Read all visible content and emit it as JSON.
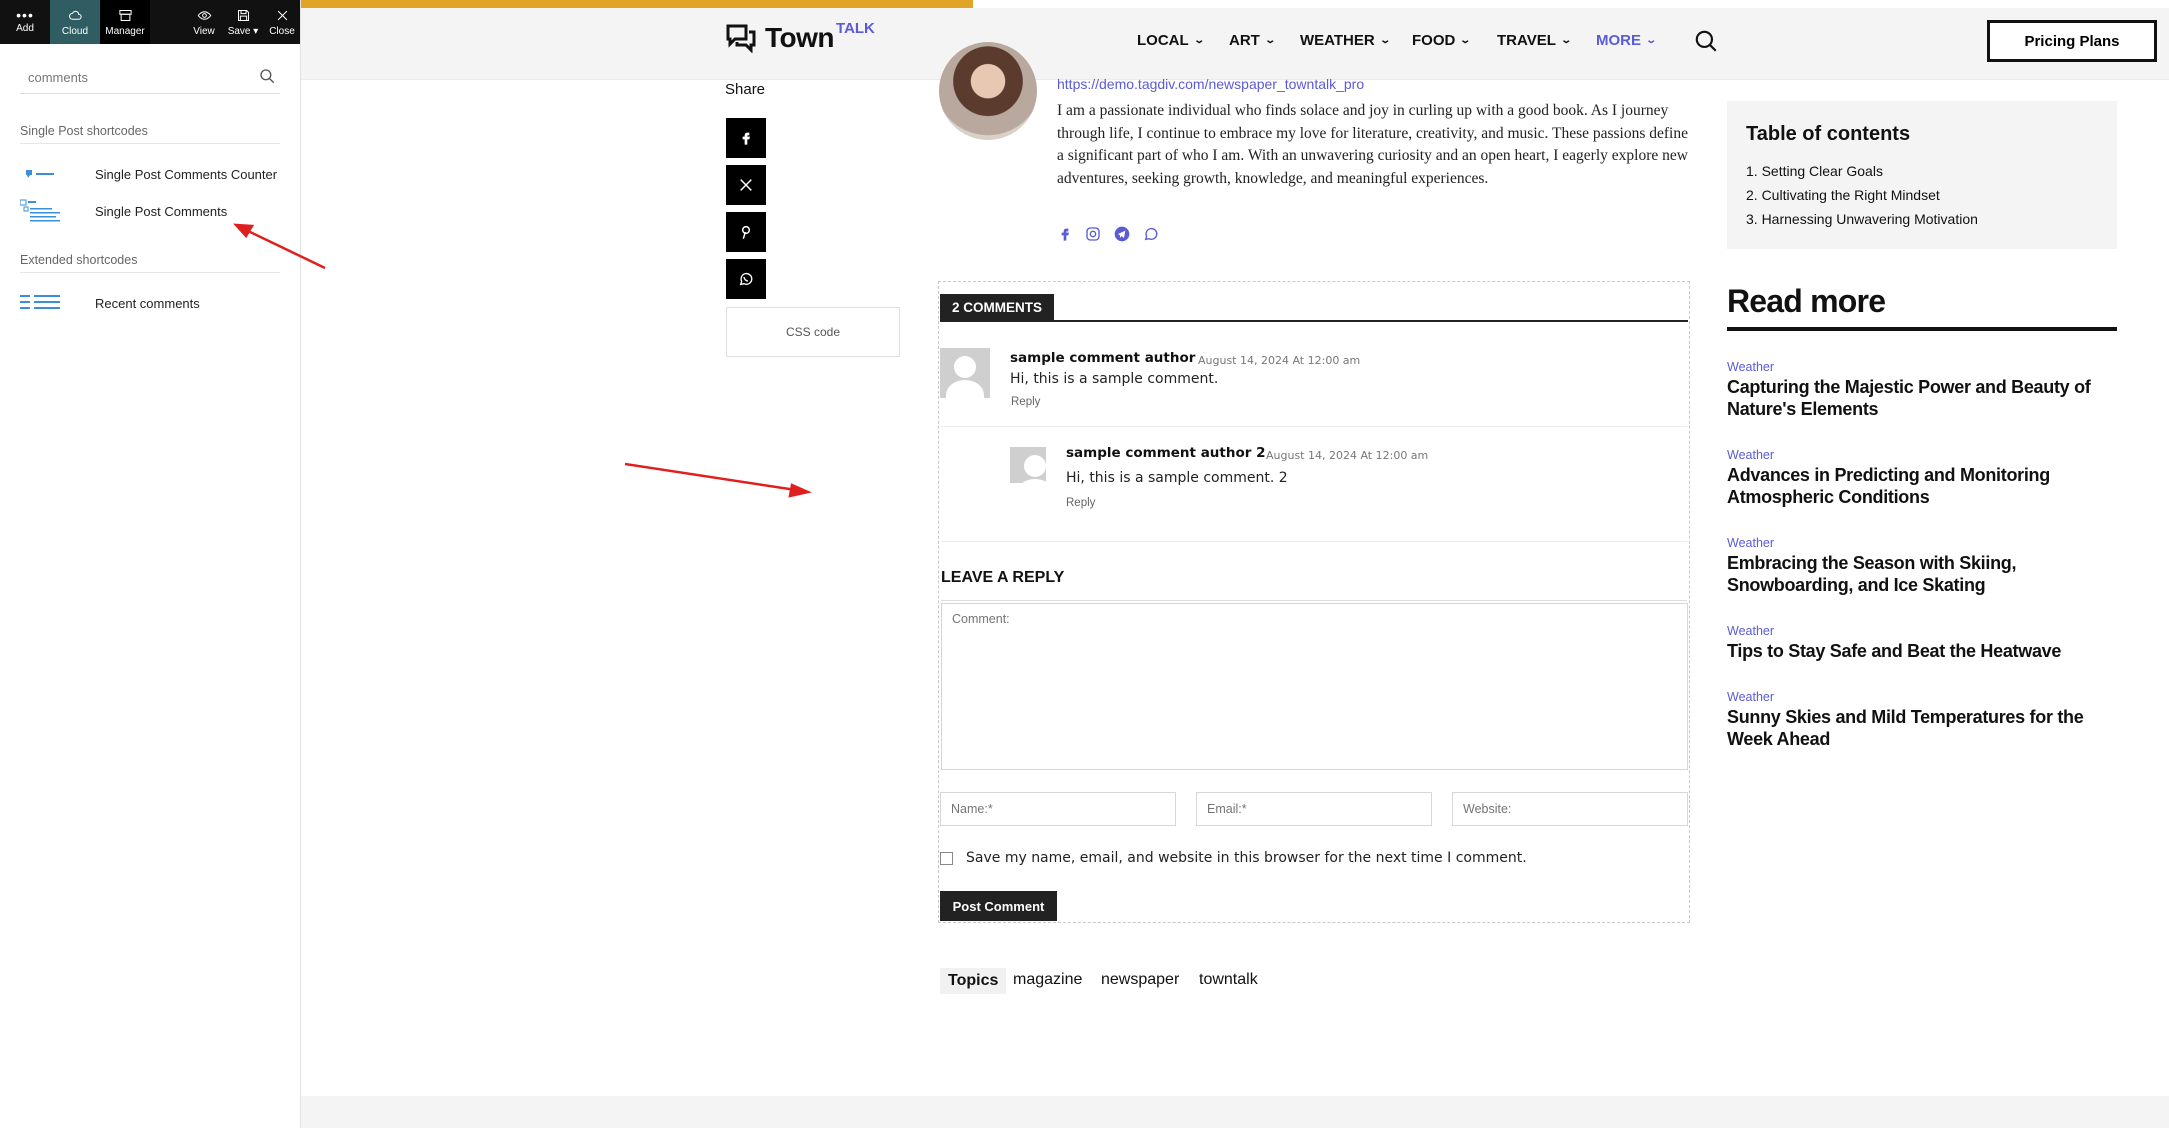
{
  "builder": {
    "toolbar": {
      "add": "Add",
      "cloud": "Cloud",
      "manager": "Manager",
      "view": "View",
      "save": "Save",
      "close": "Close"
    },
    "search": {
      "value": "comments",
      "placeholder": "comments"
    },
    "sections": [
      {
        "title": "Single Post shortcodes",
        "items": [
          "Single Post Comments Counter",
          "Single Post Comments"
        ]
      },
      {
        "title": "Extended shortcodes",
        "items": [
          "Recent comments"
        ]
      }
    ]
  },
  "header": {
    "logo_name": "Town",
    "logo_suffix": "TALK",
    "nav": [
      "LOCAL",
      "ART",
      "WEATHER",
      "FOOD",
      "TRAVEL",
      "MORE"
    ],
    "pricing_label": "Pricing Plans",
    "progress_color": "#e0a526",
    "accent_color": "#5b5bd6"
  },
  "share": {
    "label": "Share",
    "buttons": [
      "facebook-icon",
      "x-icon",
      "pinterest-icon",
      "whatsapp-icon"
    ],
    "css_code_label": "CSS code"
  },
  "author": {
    "url": "https://demo.tagdiv.com/newspaper_towntalk_pro",
    "bio": "I am a passionate individual who finds solace and joy in curling up with a good book. As I journey through life, I continue to embrace my love for literature, creativity, and music. These passions define a significant part of who I am. With an unwavering curiosity and an open heart, I eagerly explore new adventures, seeking growth, knowledge, and meaningful experiences.",
    "social": [
      "facebook-icon",
      "instagram-icon",
      "telegram-icon",
      "whatsapp-icon"
    ]
  },
  "comments": {
    "heading": "2 COMMENTS",
    "items": [
      {
        "author": "sample comment author",
        "date": "August 14, 2024 At 12:00 am",
        "text": "Hi, this is a sample comment.",
        "reply": "Reply"
      },
      {
        "author": "sample comment author 2",
        "date": "August 14, 2024 At 12:00 am",
        "text": "Hi, this is a sample comment. 2",
        "reply": "Reply"
      }
    ],
    "reply_title": "LEAVE A REPLY",
    "comment_placeholder": "Comment:",
    "name_placeholder": "Name:*",
    "email_placeholder": "Email:*",
    "website_placeholder": "Website:",
    "save_label": "Save my name, email, and website in this browser for the next time I comment.",
    "post_button": "Post Comment"
  },
  "topics": {
    "label": "Topics",
    "tags": [
      "magazine",
      "newspaper",
      "towntalk"
    ]
  },
  "sidebar": {
    "toc_title": "Table of contents",
    "toc_items": [
      "1.   Setting Clear Goals",
      "2.   Cultivating the Right Mindset",
      "3.   Harnessing Unwavering Motivation"
    ],
    "read_more_title": "Read more",
    "articles": [
      {
        "category": "Weather",
        "title": "Capturing the Majestic Power and Beauty of Nature's Elements"
      },
      {
        "category": "Weather",
        "title": "Advances in Predicting and Monitoring Atmospheric Conditions"
      },
      {
        "category": "Weather",
        "title": "Embracing the Season with Skiing, Snowboarding, and Ice Skating"
      },
      {
        "category": "Weather",
        "title": "Tips to Stay Safe and Beat the Heatwave"
      },
      {
        "category": "Weather",
        "title": "Sunny Skies and Mild Temperatures for the Week Ahead"
      }
    ]
  },
  "annotation_color": "#e02020"
}
